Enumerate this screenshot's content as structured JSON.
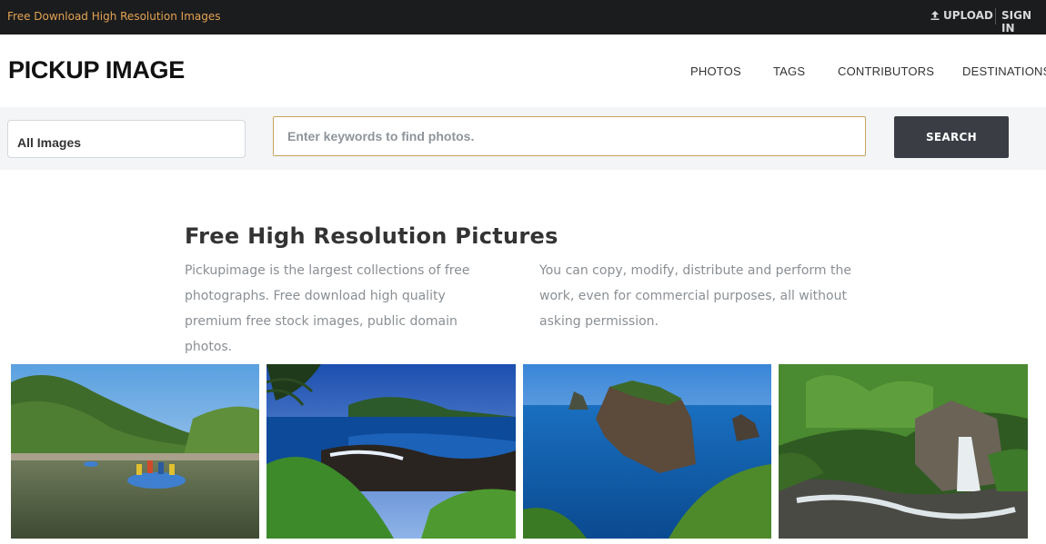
{
  "topbar": {
    "tagline": "Free Download High Resolution Images",
    "upload_label": "UPLOAD",
    "signin_label": "SIGN IN"
  },
  "header": {
    "logo": "PICKUP IMAGE",
    "nav": [
      "PHOTOS",
      "TAGS",
      "CONTRIBUTORS",
      "DESTINATIONS"
    ]
  },
  "search": {
    "category_value": "All Images",
    "placeholder": "Enter keywords to find photos.",
    "button_label": "SEARCH"
  },
  "intro": {
    "title": "Free High Resolution Pictures",
    "left_text": "Pickupimage is the largest collections of free photographs. Free download high quality premium free stock images, public domain photos.",
    "right_text": "You can copy, modify, distribute and perform the work, even for commercial purposes, all without asking permission."
  },
  "gallery": [
    {
      "subject": "river-rafting"
    },
    {
      "subject": "tropical-coast"
    },
    {
      "subject": "sea-cliffs"
    },
    {
      "subject": "forest-waterfall"
    }
  ],
  "colors": {
    "topbar_bg": "#1b1c1e",
    "tagline": "#e4a352",
    "search_button": "#3a3d44",
    "search_border": "#c9a45e"
  }
}
